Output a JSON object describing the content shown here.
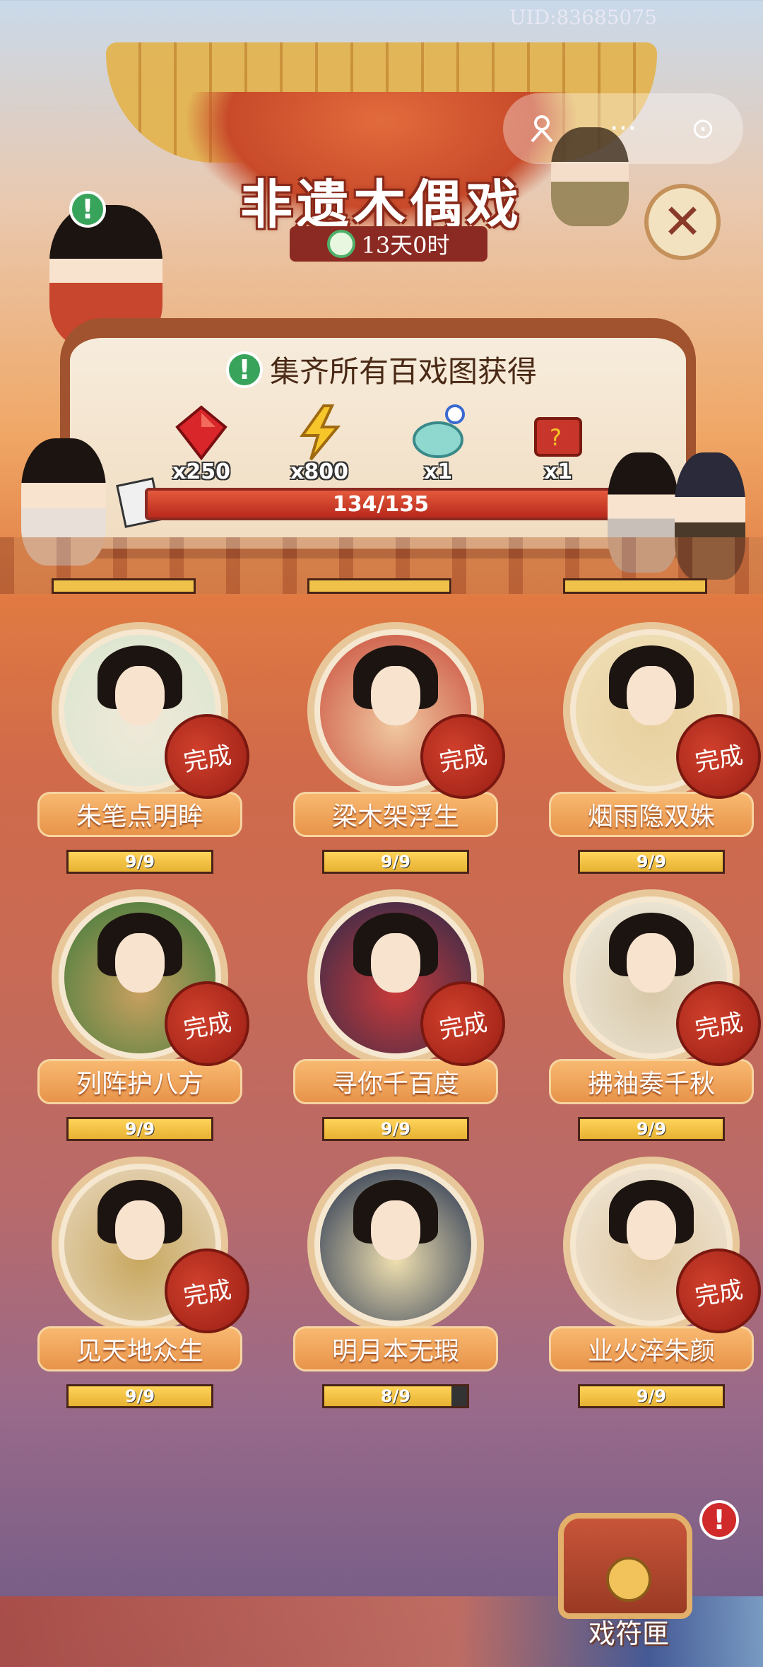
{
  "uid": "UID:83685075",
  "event": {
    "title": "非遗木偶戏",
    "countdown": "13天0时"
  },
  "menu": {
    "more_label": "···",
    "gear_label": "⊙"
  },
  "collection": {
    "heading": "集齐所有百戏图获得",
    "rewards": [
      {
        "icon": "red-gem-icon",
        "qty": "x250"
      },
      {
        "icon": "lightning-icon",
        "qty": "x800"
      },
      {
        "icon": "jade-ornament-icon",
        "qty": "x1"
      },
      {
        "icon": "mystery-chest-icon",
        "qty": "x1"
      }
    ],
    "progress_text": "134/135",
    "progress_value": 134,
    "progress_max": 135
  },
  "cards": [
    {
      "name": "朱笔点明眸",
      "status": "完成",
      "progress_text": "9/9",
      "progress": 1.0
    },
    {
      "name": "梁木架浮生",
      "status": "完成",
      "progress_text": "9/9",
      "progress": 1.0
    },
    {
      "name": "烟雨隐双姝",
      "status": "完成",
      "progress_text": "9/9",
      "progress": 1.0
    },
    {
      "name": "列阵护八方",
      "status": "完成",
      "progress_text": "9/9",
      "progress": 1.0
    },
    {
      "name": "寻你千百度",
      "status": "完成",
      "progress_text": "9/9",
      "progress": 1.0
    },
    {
      "name": "拂袖奏千秋",
      "status": "完成",
      "progress_text": "9/9",
      "progress": 1.0
    },
    {
      "name": "见天地众生",
      "status": "完成",
      "progress_text": "9/9",
      "progress": 1.0
    },
    {
      "name": "明月本无瑕",
      "status": "",
      "progress_text": "8/9",
      "progress": 0.889
    },
    {
      "name": "业火淬朱颜",
      "status": "完成",
      "progress_text": "9/9",
      "progress": 1.0
    }
  ],
  "chest": {
    "label": "戏符匣"
  },
  "colors": {
    "accent_red": "#9a1e14",
    "progress_gold": "#ffd35a",
    "alert_green": "#38a35a"
  }
}
